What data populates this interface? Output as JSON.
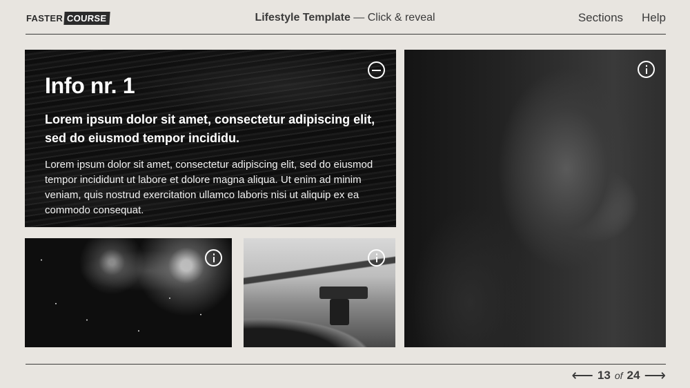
{
  "header": {
    "logo_word1": "FASTER",
    "logo_word2": "COURSE",
    "title_bold": "Lifestyle Template",
    "title_rest": " — Click & reveal",
    "nav": [
      "Sections",
      "Help"
    ]
  },
  "info_panel": {
    "heading": "Info nr. 1",
    "subheading": "Lorem ipsum dolor sit amet, consectetur adipiscing elit, sed do eiusmod tempor incididu.",
    "body": "Lorem ipsum dolor sit amet, consectetur adipiscing elit, sed do eiusmod tempor incididunt ut labore et dolore magna aliqua. Ut enim ad minim veniam, quis nostrud exercitation ullamco laboris nisi ut aliquip ex ea commodo consequat."
  },
  "icons": {
    "collapse": "minus-circle-icon",
    "info": "info-circle-icon",
    "prev": "arrow-left-icon",
    "next": "arrow-right-icon"
  },
  "pager": {
    "current": "13",
    "of": "of",
    "total": "24",
    "prev_glyph": "⟵",
    "next_glyph": "⟶"
  }
}
